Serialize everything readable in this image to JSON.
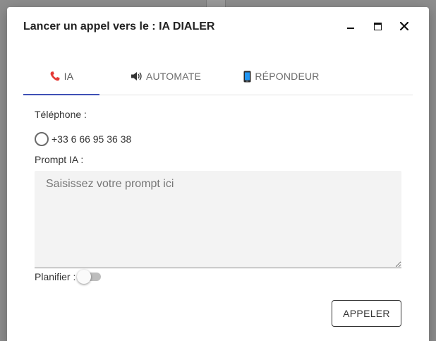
{
  "dialog": {
    "title": "Lancer un appel vers le : IA DIALER",
    "controls": [
      "minimize-icon",
      "maximize-icon",
      "close-icon"
    ]
  },
  "tabs": [
    {
      "label": "IA",
      "icon": "phone-icon",
      "active": true
    },
    {
      "label": "AUTOMATE",
      "icon": "speaker-icon",
      "active": false
    },
    {
      "label": "RÉPONDEUR",
      "icon": "mobile-phone-icon",
      "active": false
    }
  ],
  "form": {
    "telephone_label": "Téléphone :",
    "phone_option": "+33 6 66 95 36 38",
    "prompt_label": "Prompt IA :",
    "prompt_placeholder": "Saisissez votre prompt ici",
    "prompt_value": "",
    "planifier_label": "Planifier :",
    "planifier_on": false
  },
  "actions": {
    "call_label": "APPELER"
  },
  "colors": {
    "accent": "#3f51b5",
    "phone_icon": "#e53935",
    "toggle_track": "#bdbdbd"
  }
}
